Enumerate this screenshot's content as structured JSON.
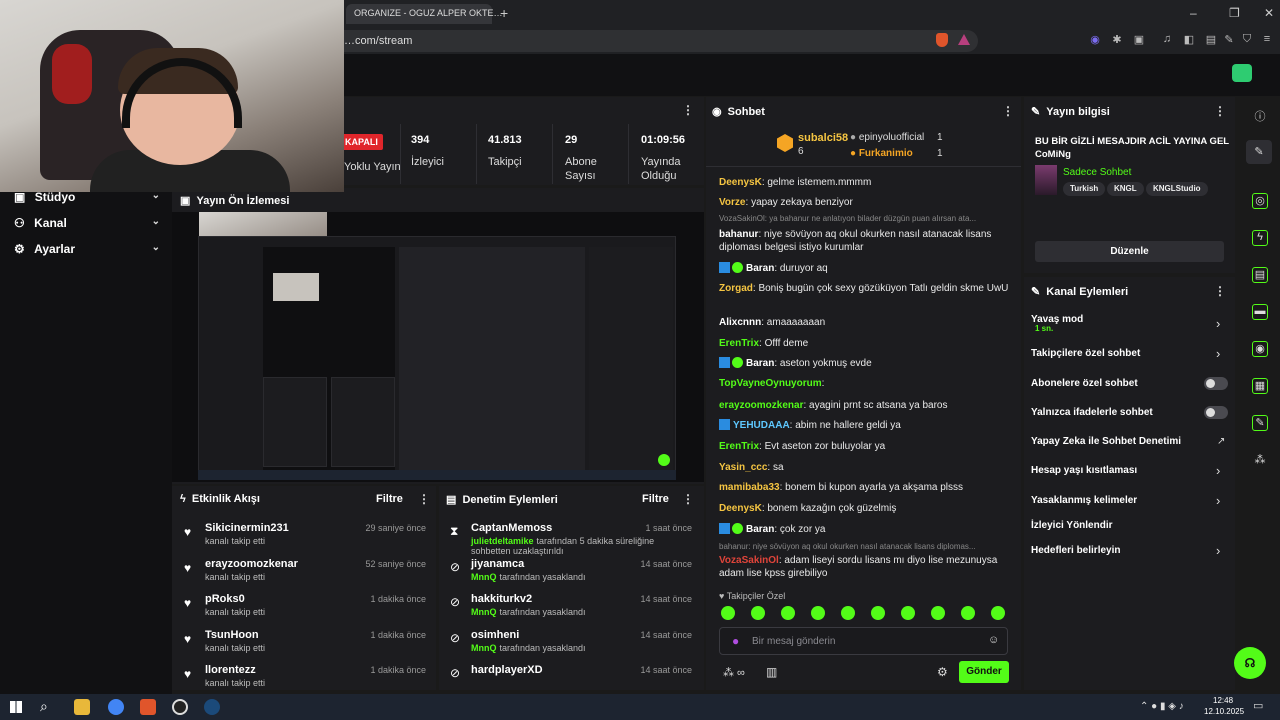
{
  "browser": {
    "tab_title": "ORGANIZE - OGUZ ALPER OKTE…",
    "url": "…com/stream",
    "new_tab": "+"
  },
  "sidebar": {
    "items": [
      {
        "label": "Stüdyo"
      },
      {
        "label": "Kanal"
      },
      {
        "label": "Ayarlar"
      }
    ]
  },
  "stats": {
    "status_badge": "KAPALI",
    "status_label": "Yoklu Yayın",
    "viewers": "394",
    "viewers_label": "İzleyici",
    "followers": "41.813",
    "followers_label": "Takipçi",
    "subs": "29",
    "subs_label": "Abone Sayısı",
    "uptime": "01:09:56",
    "uptime_label": "Yayında Olduğu"
  },
  "preview": {
    "title": "Yayın Ön İzlemesi"
  },
  "activity": {
    "title": "Etkinlik Akışı",
    "filter": "Filtre",
    "items": [
      {
        "name": "Sikicinermin231",
        "action": "kanalı takip etti",
        "time": "29 saniye önce"
      },
      {
        "name": "erayzoomozkenar",
        "action": "kanalı takip etti",
        "time": "52 saniye önce"
      },
      {
        "name": "pRoks0",
        "action": "kanalı takip etti",
        "time": "1 dakika önce"
      },
      {
        "name": "TsunHoon",
        "action": "kanalı takip etti",
        "time": "1 dakika önce"
      },
      {
        "name": "llorentezz",
        "action": "kanalı takip etti",
        "time": "1 dakika önce"
      }
    ]
  },
  "moderation": {
    "title": "Denetim Eylemleri",
    "filter": "Filtre",
    "items": [
      {
        "name": "CaptanMemoss",
        "actor": "julietdeltamike",
        "text": "tarafından 5 dakika süreliğine sohbetten uzaklaştırıldı",
        "time": "1 saat önce"
      },
      {
        "name": "jiyanamca",
        "actor": "MnnQ",
        "text": "tarafından yasaklandı",
        "time": "14 saat önce"
      },
      {
        "name": "hakkiturkv2",
        "actor": "MnnQ",
        "text": "tarafından yasaklandı",
        "time": "14 saat önce"
      },
      {
        "name": "osimheni",
        "actor": "MnnQ",
        "text": "tarafından yasaklandı",
        "time": "14 saat önce"
      },
      {
        "name": "hardplayerXD",
        "actor": "",
        "text": "",
        "time": "14 saat önce"
      }
    ]
  },
  "chat": {
    "title": "Sohbet",
    "top_gifter": {
      "name": "subalci58",
      "count": "6"
    },
    "leaders": [
      {
        "name": "epinyoluofficial",
        "count": "1"
      },
      {
        "name": "Furkanimio",
        "count": "1"
      }
    ],
    "messages": [
      {
        "user": "DeenysK",
        "text": "gelme istemem.mmmm",
        "color": "#f5c542"
      },
      {
        "user": "Vorze",
        "text": "yapay zekaya benziyor",
        "color": "#f5c542"
      },
      {
        "reply": "VozaSakinOl: ya bahanur ne anlatıyon bilader düzgün puan alırsan ata..."
      },
      {
        "user": "bahanur",
        "text": "niye sövüyon aq okul okurken nasıl atanacak lisans diploması belgesi istiyo kurumlar",
        "color": "#ffffff"
      },
      {
        "user": "Baran",
        "text": "duruyor aq",
        "color": "#ffffff",
        "badge": true
      },
      {
        "user": "Zorgad",
        "text": "Boniş bugün çok sexy gözüküyon Tatlı geldin skme UwU",
        "color": "#f5c542"
      },
      {
        "user": "Alixcnnn",
        "text": "amaaaaaaan",
        "color": "#ffffff"
      },
      {
        "user": "ErenTrix",
        "text": "Offf deme",
        "color": "#53fc18"
      },
      {
        "user": "Baran",
        "text": "aseton yokmuş evde",
        "color": "#ffffff",
        "badge": true
      },
      {
        "user": "TopVayneOynuyorum",
        "text": "",
        "color": "#53fc18"
      },
      {
        "user": "erayzoomozkenar",
        "text": "ayagini prnt sc atsana ya baros",
        "color": "#53fc18"
      },
      {
        "user": "YEHUDAAA",
        "text": "abim ne hallere geldi ya",
        "color": "#5ec8ff",
        "badge2": true
      },
      {
        "user": "ErenTrix",
        "text": "Evt aseton zor buluyolar ya",
        "color": "#53fc18"
      },
      {
        "user": "Yasin_ccc",
        "text": "sa",
        "color": "#f5c542"
      },
      {
        "user": "mamibaba33",
        "text": "bonem bi kupon ayarla ya akşama plsss",
        "color": "#f5c542"
      },
      {
        "user": "DeenysK",
        "text": "bonem kazağın çok güzelmiş",
        "color": "#f5c542"
      },
      {
        "user": "Baran",
        "text": "çok zor ya",
        "color": "#ffffff",
        "badge": true
      },
      {
        "reply": "bahanur: niye sövüyon aq okul okurken nasıl atanacak lisans diplomas..."
      },
      {
        "user": "VozaSakinOl",
        "text": "adam liseyi sordu lisans mı diyo lise mezunuysa adam lise kpss girebiliyo",
        "color": "#e0443a"
      }
    ],
    "follower_only": "Takipçiler Özel",
    "placeholder": "Bir mesaj gönderin",
    "send": "Gönder"
  },
  "info": {
    "title": "Yayın bilgisi",
    "stream_title": "BU BİR GİZLİ MESAJDIR ACİL YAYINA GEL CoMiNg",
    "category": "Sadece Sohbet",
    "tags": [
      "Turkish",
      "KNGL",
      "KNGLStudio"
    ],
    "edit": "Düzenle"
  },
  "channel_actions": {
    "title": "Kanal Eylemleri",
    "slow_mode": "Yavaş mod",
    "slow_value": "1 sn.",
    "followers_only": "Takipçilere özel sohbet",
    "subs_only": "Abonelere özel sohbet",
    "emotes_only": "Yalnızca ifadelerle sohbet",
    "ai_mod": "Yapay Zeka ile Sohbet Denetimi",
    "age_limit": "Hesap yaşı kısıtlaması",
    "banned_words": "Yasaklanmış kelimeler",
    "redirect": "İzleyici Yönlendir",
    "goals": "Hedefleri belirleyin"
  },
  "taskbar": {
    "time": "12:48",
    "date": "12.10.2025"
  },
  "colors": {
    "accent": "#53fc18",
    "panel": "#1c1c1f",
    "bg": "#111113"
  }
}
